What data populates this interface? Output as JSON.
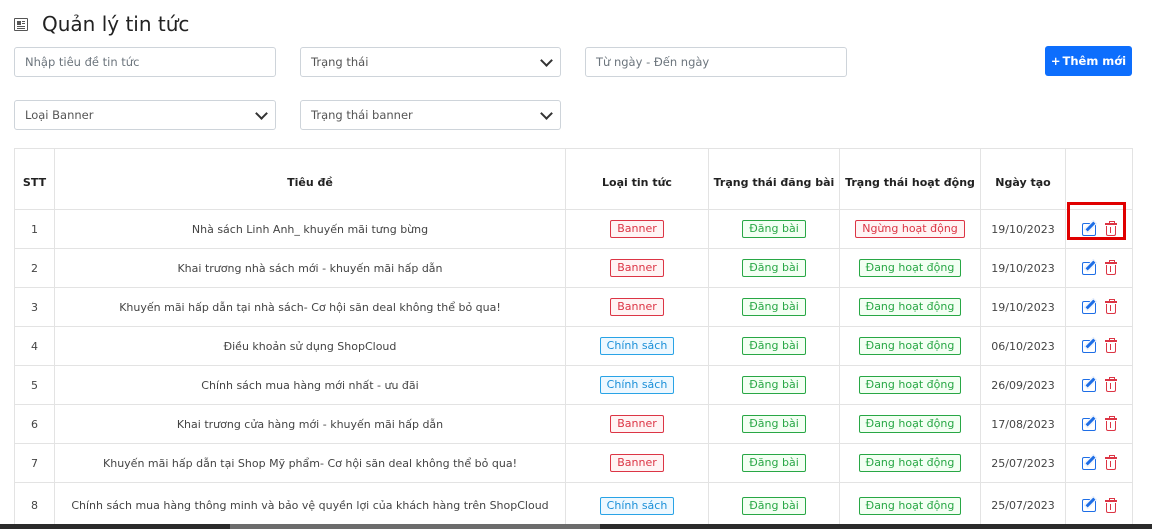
{
  "page": {
    "title": "Quản lý tin tức",
    "icon": "newspaper-icon"
  },
  "filters": {
    "title_placeholder": "Nhập tiêu đề tin tức",
    "status_select": "Trạng thái",
    "date_placeholder": "Từ ngày - Đến ngày",
    "banner_type_select": "Loại Banner",
    "banner_status_select": "Trạng thái banner"
  },
  "add_button": {
    "label": "Thêm mới",
    "icon": "plus-icon"
  },
  "table": {
    "headers": [
      "STT",
      "Tiêu đề",
      "Loại tin tức",
      "Trạng thái đăng bài",
      "Trạng thái hoạt động",
      "Ngày tạo",
      ""
    ],
    "rows": [
      {
        "stt": "1",
        "title": "Nhà sách Linh Anh_ khuyến mãi tưng bừng",
        "type": "Banner",
        "post": "Đăng bài",
        "active": "Ngừng hoạt động",
        "date": "19/10/2023"
      },
      {
        "stt": "2",
        "title": "Khai trương nhà sách mới - khuyến mãi hấp dẫn",
        "type": "Banner",
        "post": "Đăng bài",
        "active": "Đang hoạt động",
        "date": "19/10/2023"
      },
      {
        "stt": "3",
        "title": "Khuyến mãi hấp dẫn tại nhà sách- Cơ hội săn deal không thể bỏ qua!",
        "type": "Banner",
        "post": "Đăng bài",
        "active": "Đang hoạt động",
        "date": "19/10/2023"
      },
      {
        "stt": "4",
        "title": "Điều khoản sử dụng ShopCloud",
        "type": "Chính sách",
        "post": "Đăng bài",
        "active": "Đang hoạt động",
        "date": "06/10/2023"
      },
      {
        "stt": "5",
        "title": "Chính sách mua hàng mới nhất - ưu đãi",
        "type": "Chính sách",
        "post": "Đăng bài",
        "active": "Đang hoạt động",
        "date": "26/09/2023"
      },
      {
        "stt": "6",
        "title": "Khai trương cửa hàng mới - khuyến mãi hấp dẫn",
        "type": "Banner",
        "post": "Đăng bài",
        "active": "Đang hoạt động",
        "date": "17/08/2023"
      },
      {
        "stt": "7",
        "title": "Khuyến mãi hấp dẫn tại Shop Mỹ phẩm- Cơ hội săn deal không thể bỏ qua!",
        "type": "Banner",
        "post": "Đăng bài",
        "active": "Đang hoạt động",
        "date": "25/07/2023"
      },
      {
        "stt": "8",
        "title": "Chính sách mua hàng thông minh và bảo vệ quyền lợi của khách hàng trên ShopCloud",
        "type": "Chính sách",
        "post": "Đăng bài",
        "active": "Đang hoạt động",
        "date": "25/07/2023"
      }
    ]
  },
  "colors": {
    "primary": "#0d6efd",
    "danger": "#dc3545",
    "success": "#28a745",
    "info": "#29a3e6",
    "highlight": "#e00000"
  }
}
